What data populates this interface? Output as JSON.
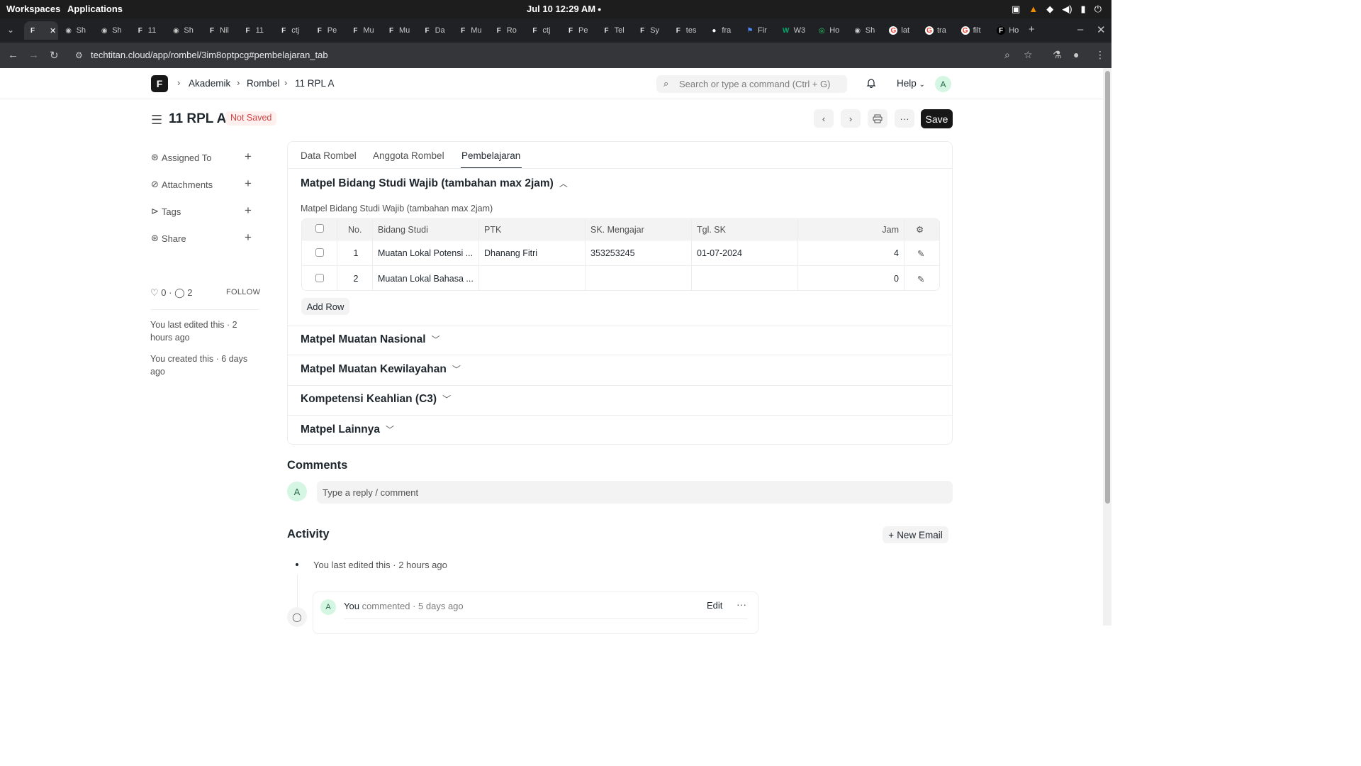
{
  "os": {
    "workspaces": "Workspaces",
    "applications": "Applications",
    "clock": "Jul 10  12:29 AM"
  },
  "browser": {
    "tabs": [
      {
        "label": "",
        "fav": "frappe",
        "active": true
      },
      {
        "label": "Sh",
        "fav": "globe"
      },
      {
        "label": "Sh",
        "fav": "globe"
      },
      {
        "label": "11",
        "fav": "frappe"
      },
      {
        "label": "Sh",
        "fav": "globe"
      },
      {
        "label": "Nil",
        "fav": "frappe"
      },
      {
        "label": "11",
        "fav": "frappe"
      },
      {
        "label": "ctj",
        "fav": "frappe"
      },
      {
        "label": "Pe",
        "fav": "frappe"
      },
      {
        "label": "Mu",
        "fav": "frappe"
      },
      {
        "label": "Mu",
        "fav": "frappe"
      },
      {
        "label": "Da",
        "fav": "frappe"
      },
      {
        "label": "Mu",
        "fav": "frappe"
      },
      {
        "label": "Ro",
        "fav": "frappe"
      },
      {
        "label": "ctj",
        "fav": "frappe"
      },
      {
        "label": "Pe",
        "fav": "frappe"
      },
      {
        "label": "Tel",
        "fav": "frappe"
      },
      {
        "label": "Sy",
        "fav": "frappe"
      },
      {
        "label": "tes",
        "fav": "frappe"
      },
      {
        "label": "fra",
        "fav": "github"
      },
      {
        "label": "Fir",
        "fav": "flag"
      },
      {
        "label": "W3",
        "fav": "w3"
      },
      {
        "label": "Ho",
        "fav": "whatsapp"
      },
      {
        "label": "Sh",
        "fav": "globe"
      },
      {
        "label": "lat",
        "fav": "google"
      },
      {
        "label": "tra",
        "fav": "google"
      },
      {
        "label": "filt",
        "fav": "google"
      },
      {
        "label": "Ho",
        "fav": "frappe-dark"
      }
    ],
    "url": "techtitan.cloud/app/rombel/3im8optpcg#pembelajaran_tab"
  },
  "appnav": {
    "logo": "F",
    "breadcrumbs": [
      "Akademik",
      "Rombel",
      "11 RPL A"
    ],
    "search_placeholder": "Search or type a command (Ctrl + G)",
    "help": "Help",
    "avatar": "A"
  },
  "doc": {
    "title": "11 RPL A",
    "status": "Not Saved",
    "save": "Save"
  },
  "sidebar": {
    "items": [
      "Assigned To",
      "Attachments",
      "Tags",
      "Share"
    ],
    "likes": "0",
    "comments": "2",
    "follow": "FOLLOW",
    "last_edited": "You last edited this · 2 hours ago",
    "created": "You created this · 6 days ago"
  },
  "tabs": [
    "Data Rombel",
    "Anggota Rombel",
    "Pembelajaran"
  ],
  "sections": [
    {
      "title": "Matpel Bidang Studi Wajib (tambahan max 2jam)",
      "open": true
    },
    {
      "title": "Matpel Muatan Nasional",
      "open": false
    },
    {
      "title": "Matpel Muatan Kewilayahan",
      "open": false
    },
    {
      "title": "Kompetensi Keahlian (C3)",
      "open": false
    },
    {
      "title": "Matpel Lainnya",
      "open": false
    }
  ],
  "grid": {
    "label": "Matpel Bidang Studi Wajib (tambahan max 2jam)",
    "headers": [
      "No.",
      "Bidang Studi",
      "PTK",
      "SK. Mengajar",
      "Tgl. SK",
      "Jam"
    ],
    "rows": [
      {
        "no": "1",
        "bidang_studi": "Muatan Lokal Potensi ...",
        "ptk": "Dhanang Fitri",
        "sk": "353253245",
        "tgl": "01-07-2024",
        "jam": "4"
      },
      {
        "no": "2",
        "bidang_studi": "Muatan Lokal Bahasa ...",
        "ptk": "",
        "sk": "",
        "tgl": "",
        "jam": "0"
      }
    ],
    "add_row": "Add Row"
  },
  "comments": {
    "heading": "Comments",
    "avatar": "A",
    "placeholder": "Type a reply / comment"
  },
  "activity": {
    "heading": "Activity",
    "new_email": "New Email",
    "last_edited": "You last edited this · 2 hours ago",
    "comment_author": "You",
    "comment_meta": "commented · 5 days ago",
    "edit": "Edit",
    "avatar": "A"
  }
}
